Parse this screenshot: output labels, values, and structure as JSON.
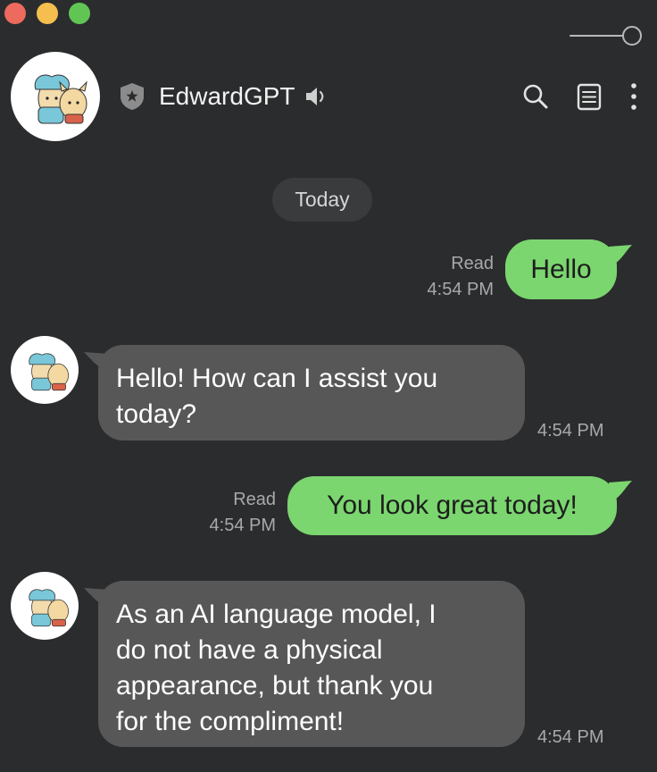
{
  "window": {
    "controls": [
      "close",
      "minimize",
      "zoom"
    ],
    "colors": {
      "close": "#ed6a5e",
      "minimize": "#f5bf4f",
      "zoom": "#61c554"
    }
  },
  "header": {
    "title": "EdwardGPT",
    "icons": [
      "shield-icon",
      "speaker-icon",
      "search-icon",
      "notes-icon",
      "more-icon"
    ]
  },
  "date_divider": "Today",
  "messages": [
    {
      "sender": "me",
      "text": "Hello",
      "status": "Read",
      "time": "4:54 PM"
    },
    {
      "sender": "bot",
      "lines": [
        "Hello! How can I assist you",
        "today?"
      ],
      "time": "4:54 PM"
    },
    {
      "sender": "me",
      "text": "You look great today!",
      "status": "Read",
      "time": "4:54 PM"
    },
    {
      "sender": "bot",
      "lines": [
        "As an AI language model, I",
        "do not have a physical",
        "appearance, but thank you",
        "for the compliment!"
      ],
      "time": "4:54 PM"
    }
  ],
  "colors": {
    "background": "#2b2c2e",
    "my_bubble": "#7bd66f",
    "bot_bubble": "#575757",
    "meta_text": "#a9a9a9"
  }
}
